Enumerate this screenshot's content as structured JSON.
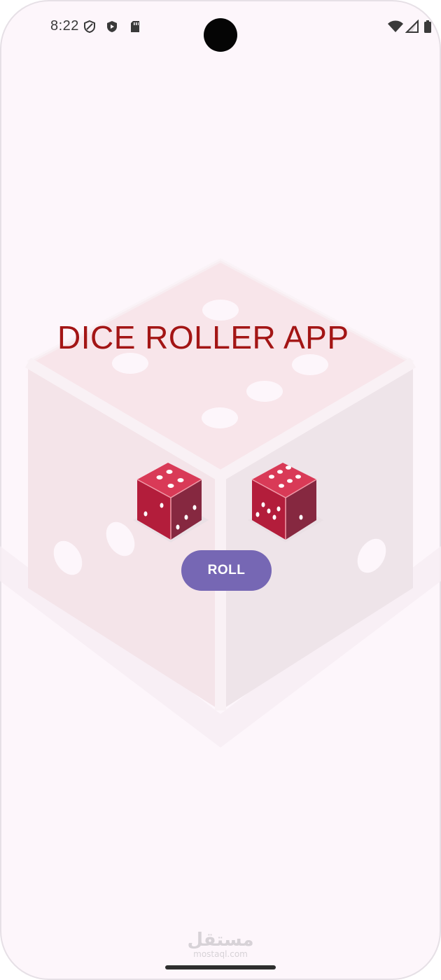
{
  "status_bar": {
    "time": "8:22",
    "left_icons": [
      "shield-outline-icon",
      "shield-play-icon",
      "sd-card-icon"
    ],
    "right_icons": [
      "wifi-icon",
      "cellular-signal-icon",
      "battery-icon"
    ]
  },
  "app": {
    "title": "DICE ROLLER APP",
    "roll_button_label": "ROLL",
    "background_illustration": "large-faded-dice-icon",
    "dice": [
      {
        "name": "die-left",
        "top_face": 4,
        "color": "#c22a45"
      },
      {
        "name": "die-right",
        "top_face": 6,
        "color": "#c22a45"
      }
    ]
  },
  "watermark": {
    "arabic": "مستقل",
    "latin": "mostaql.com"
  },
  "colors": {
    "background": "#fdf6fb",
    "title": "#a31515",
    "button": "#7667b4",
    "die_face": "#c22a45"
  }
}
